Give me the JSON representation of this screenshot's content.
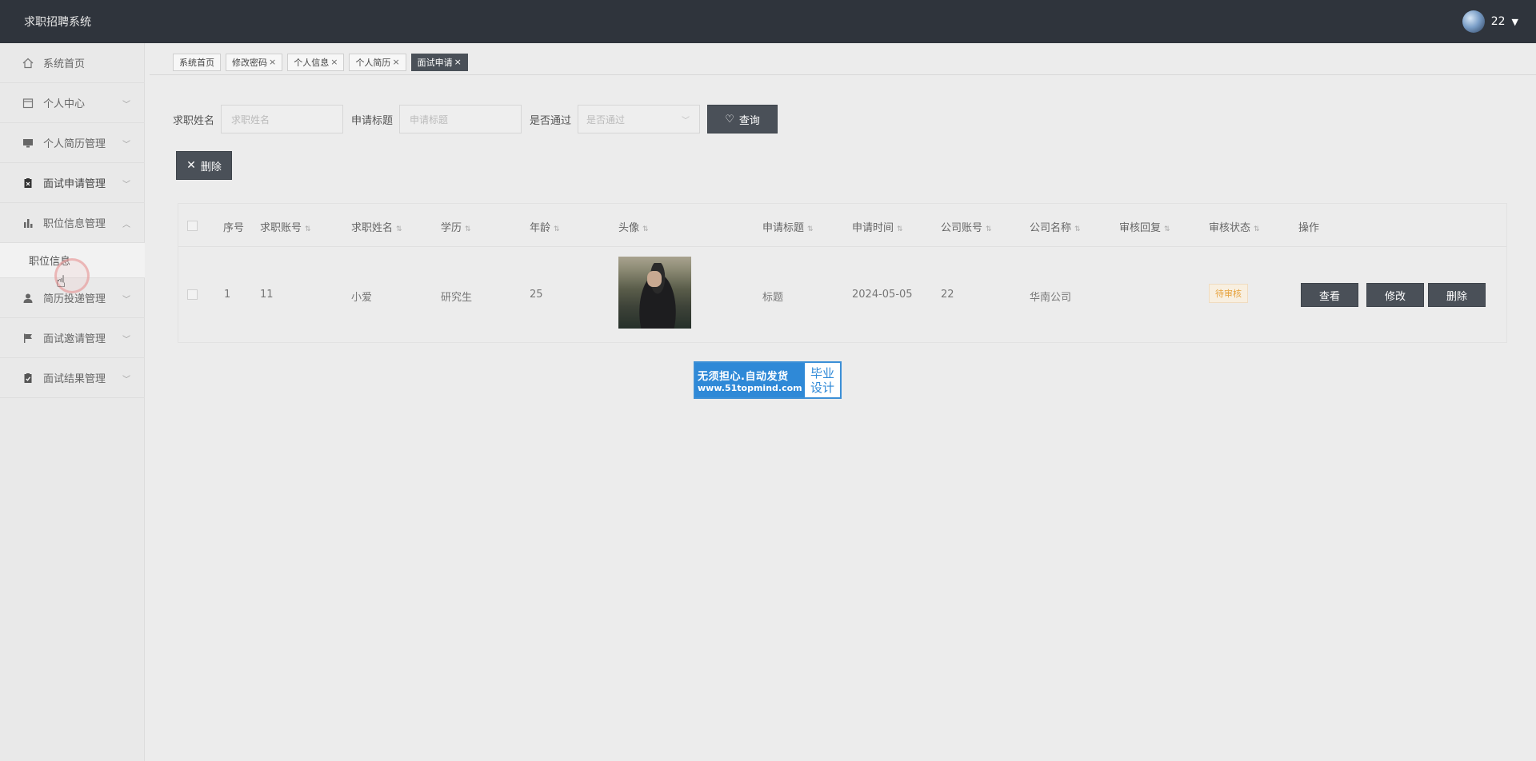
{
  "header": {
    "app_title": "求职招聘系统",
    "username": "22"
  },
  "sidebar": {
    "items": [
      {
        "label": "系统首页",
        "icon": "home-icon"
      },
      {
        "label": "个人中心",
        "icon": "calendar-icon"
      },
      {
        "label": "个人简历管理",
        "icon": "monitor-icon"
      },
      {
        "label": "面试申请管理",
        "icon": "clipboard-icon"
      },
      {
        "label": "职位信息管理",
        "icon": "bar-chart-icon"
      },
      {
        "label": "简历投递管理",
        "icon": "user-icon"
      },
      {
        "label": "面试邀请管理",
        "icon": "flag-icon"
      },
      {
        "label": "面试结果管理",
        "icon": "clipboard-check-icon"
      }
    ],
    "submenu": {
      "label": "职位信息"
    }
  },
  "tabs": [
    {
      "label": "系统首页",
      "closable": false
    },
    {
      "label": "修改密码",
      "closable": true
    },
    {
      "label": "个人信息",
      "closable": true
    },
    {
      "label": "个人简历",
      "closable": true
    },
    {
      "label": "面试申请",
      "closable": true,
      "active": true
    }
  ],
  "tab_close_glyph": "×",
  "search": {
    "name_label": "求职姓名",
    "name_placeholder": "求职姓名",
    "title_label": "申请标题",
    "title_placeholder": "申请标题",
    "pass_label": "是否通过",
    "pass_placeholder": "是否通过",
    "query_button": "查询"
  },
  "actions": {
    "delete_button": "删除"
  },
  "table": {
    "columns": [
      "序号",
      "求职账号",
      "求职姓名",
      "学历",
      "年龄",
      "头像",
      "申请标题",
      "申请时间",
      "公司账号",
      "公司名称",
      "审核回复",
      "审核状态",
      "操作"
    ],
    "rows": [
      {
        "index": "1",
        "account": "11",
        "name": "小爱",
        "education": "研究生",
        "age": "25",
        "title": "标题",
        "time": "2024-05-05",
        "company_account": "22",
        "company_name": "华南公司",
        "reply": "",
        "status": "待审核",
        "btn_view": "查看",
        "btn_edit": "修改",
        "btn_delete": "删除"
      }
    ]
  },
  "watermark": {
    "line1": "无须担心.自动发货",
    "line2": "www.51topmind.com",
    "right1": "毕业",
    "right2": "设计"
  },
  "colors": {
    "header_bg": "#2f343c",
    "button_dark": "#4a5058",
    "status_warning": "#e6a23c",
    "watermark_blue": "#2f89d7"
  }
}
